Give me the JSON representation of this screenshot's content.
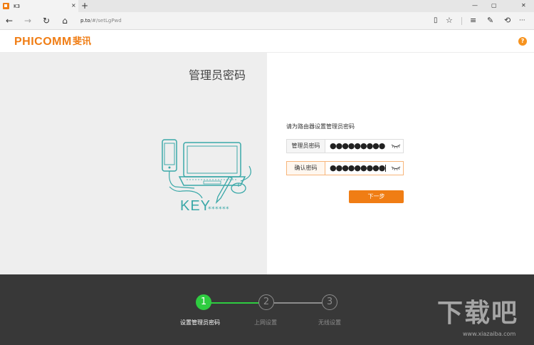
{
  "browser": {
    "tab_title": "K3",
    "tab_close": "×",
    "new_tab": "+",
    "window_controls": {
      "minimize": "—",
      "maximize": "▢",
      "close": "✕"
    },
    "nav": {
      "back": "←",
      "forward": "→",
      "refresh": "↻",
      "home": "⌂"
    },
    "address_host": "p.to",
    "address_path": "/#/setLgPwd",
    "toolbar_icons": [
      "reading-view-icon",
      "favorite-star-icon",
      "hub-icon",
      "web-note-icon",
      "share-icon",
      "more-icon"
    ],
    "toolbar_glyphs": {
      "reading": "▯",
      "favorite": "☆",
      "hub": "≡",
      "note": "✎",
      "share": "⟲",
      "more": "···"
    }
  },
  "header": {
    "logo": "PHICOMM",
    "logo_cn": "斐讯",
    "help_badge": "?"
  },
  "illustration": {
    "title": "管理员密码",
    "key_text": "KEY",
    "key_stars": "******"
  },
  "form": {
    "instruction": "请为路由器设置管理员密码",
    "password_label": "管理员密码",
    "password_value": "●●●●●●●●●",
    "confirm_label": "确认密码",
    "confirm_value": "●●●●●●●●●",
    "next_button": "下一步"
  },
  "steps": [
    {
      "number": "1",
      "label": "设置管理员密码",
      "active": true
    },
    {
      "number": "2",
      "label": "上网设置",
      "active": false
    },
    {
      "number": "3",
      "label": "无线设置",
      "active": false
    }
  ],
  "watermark": {
    "big": "下载吧",
    "small": "www.xiazaiba.com"
  },
  "colors": {
    "accent": "#f07d14",
    "step_active": "#2ecc40",
    "footer_bg": "#383838",
    "illustration": "#3aa8a8"
  }
}
